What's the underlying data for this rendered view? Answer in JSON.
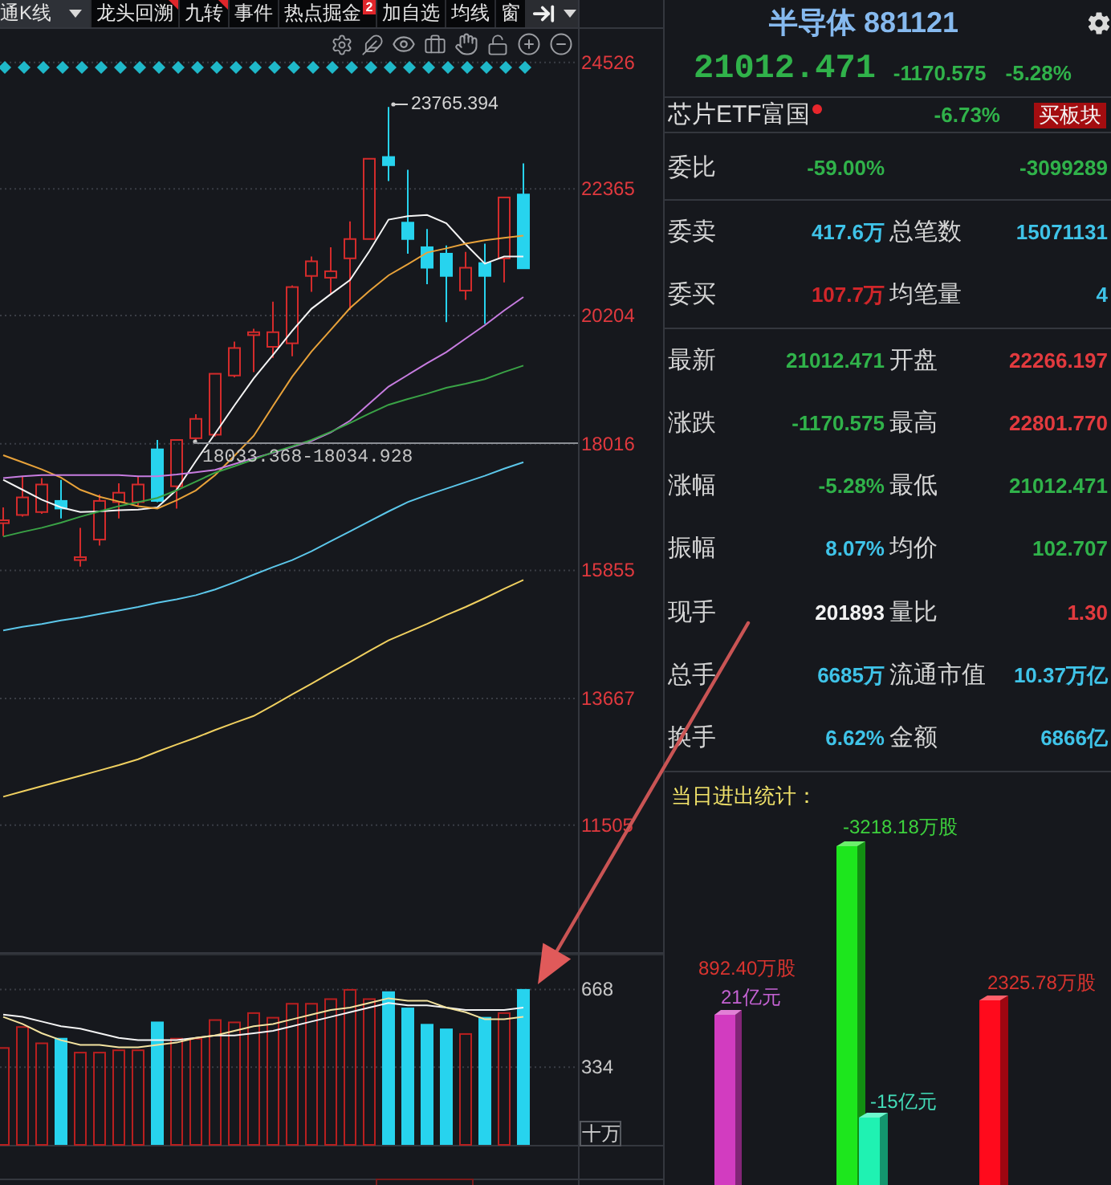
{
  "toolbar": {
    "tabs": [
      {
        "label": "通K线",
        "kind": "select",
        "flag": false
      },
      {
        "label": "龙头回溯",
        "kind": "tab",
        "flag": true
      },
      {
        "label": "九转",
        "kind": "tab",
        "flag": true
      },
      {
        "label": "事件",
        "kind": "tab",
        "flag": false
      },
      {
        "label": "热点掘金",
        "kind": "tab",
        "flag": false,
        "badge": "2"
      },
      {
        "label": "加自选",
        "kind": "tab",
        "flag": false
      },
      {
        "label": "均线",
        "kind": "tab",
        "flag": false
      },
      {
        "label": "窗",
        "kind": "tab",
        "flag": false
      }
    ]
  },
  "chart": {
    "chart_data": {
      "type": "candlestick",
      "ylim": [
        9310,
        25590
      ],
      "yticks": [
        24526,
        22365,
        20204,
        18016,
        15855,
        13667,
        11505
      ],
      "grid": true,
      "ohlc": [
        [
          16660,
          16930,
          16440,
          16710
        ],
        [
          16800,
          17450,
          16770,
          17100
        ],
        [
          16850,
          17430,
          16820,
          17320
        ],
        [
          17040,
          17400,
          16740,
          16910
        ],
        [
          16030,
          16580,
          15920,
          16080
        ],
        [
          16380,
          17150,
          16280,
          17040
        ],
        [
          17020,
          17340,
          16740,
          17180
        ],
        [
          17020,
          17450,
          16960,
          17320
        ],
        [
          17920,
          18080,
          17020,
          17040
        ],
        [
          17290,
          18080,
          16910,
          18080
        ],
        [
          18110,
          18520,
          18080,
          18440
        ],
        [
          18170,
          19210,
          18140,
          19210
        ],
        [
          19180,
          19760,
          19150,
          19650
        ],
        [
          19870,
          19980,
          19240,
          19920
        ],
        [
          19670,
          20440,
          19480,
          19920
        ],
        [
          19730,
          20720,
          19510,
          20690
        ],
        [
          20880,
          21210,
          20610,
          21130
        ],
        [
          20850,
          21370,
          20580,
          20960
        ],
        [
          21180,
          21810,
          20300,
          21510
        ],
        [
          21510,
          22880,
          21510,
          22880
        ],
        [
          22910,
          23765,
          22500,
          22770
        ],
        [
          21790,
          22690,
          21260,
          21510
        ],
        [
          21370,
          21680,
          20740,
          21020
        ],
        [
          21260,
          21400,
          20090,
          20880
        ],
        [
          20630,
          21290,
          20470,
          21020
        ],
        [
          21100,
          21430,
          20060,
          20880
        ],
        [
          21180,
          22220,
          20770,
          22220
        ],
        [
          22270,
          22800,
          21010,
          21010
        ]
      ],
      "series": [
        {
          "type": "line",
          "color": "#f4f4f4",
          "values": [
            17400,
            17230,
            17060,
            16930,
            16850,
            16860,
            16880,
            16890,
            16930,
            17230,
            17720,
            18190,
            18670,
            19130,
            19530,
            19940,
            20320,
            20570,
            20810,
            21300,
            21840,
            21900,
            21920,
            21780,
            21420,
            21090,
            21210,
            21210
          ]
        },
        {
          "type": "line",
          "color": "#e8a23a",
          "values": [
            17820,
            17700,
            17580,
            17440,
            17230,
            17110,
            17030,
            16950,
            16910,
            17050,
            17220,
            17480,
            17810,
            18150,
            18660,
            19160,
            19590,
            19960,
            20330,
            20620,
            20890,
            21080,
            21280,
            21350,
            21430,
            21490,
            21530,
            21570
          ]
        },
        {
          "type": "line",
          "color": "#c77ce0",
          "values": [
            17430,
            17460,
            17480,
            17480,
            17480,
            17480,
            17480,
            17460,
            17460,
            17490,
            17530,
            17570,
            17670,
            17770,
            17860,
            17960,
            18060,
            18210,
            18410,
            18700,
            18990,
            19190,
            19390,
            19580,
            19810,
            20040,
            20290,
            20520
          ]
        },
        {
          "type": "line",
          "color": "#3aa346",
          "values": [
            16430,
            16510,
            16580,
            16670,
            16770,
            16860,
            16950,
            17020,
            17090,
            17220,
            17370,
            17520,
            17630,
            17750,
            17870,
            17970,
            18080,
            18220,
            18370,
            18530,
            18680,
            18780,
            18870,
            18970,
            19040,
            19120,
            19240,
            19350
          ]
        },
        {
          "type": "line",
          "color": "#5cc7ea",
          "values": [
            14830,
            14890,
            14940,
            15000,
            15050,
            15110,
            15170,
            15230,
            15300,
            15360,
            15430,
            15530,
            15650,
            15780,
            15910,
            16030,
            16180,
            16350,
            16520,
            16690,
            16860,
            17020,
            17140,
            17250,
            17360,
            17470,
            17590,
            17700
          ]
        },
        {
          "type": "line",
          "color": "#f0d060",
          "values": [
            11990,
            12080,
            12170,
            12260,
            12350,
            12440,
            12530,
            12630,
            12760,
            12880,
            13000,
            13130,
            13250,
            13370,
            13550,
            13740,
            13920,
            14110,
            14290,
            14480,
            14660,
            14800,
            14940,
            15090,
            15230,
            15380,
            15540,
            15690
          ]
        }
      ]
    },
    "high_label": "23765.394",
    "range_label": "18033.368-18034.928"
  },
  "volume": {
    "chart_data": {
      "type": "bar",
      "ylim": [
        0,
        818
      ],
      "yticks": [
        668,
        334
      ],
      "grid": true,
      "series": [
        {
          "color": "#b81f1f",
          "values": [
            420,
            510,
            440,
            null,
            400,
            400,
            410,
            410,
            null,
            460,
            460,
            540,
            530,
            570,
            550,
            610,
            610,
            630,
            670,
            630,
            null,
            null,
            null,
            null,
            480,
            null,
            570,
            null
          ]
        },
        {
          "color": "#27d3ee",
          "values": [
            null,
            null,
            null,
            460,
            null,
            null,
            null,
            null,
            530,
            null,
            null,
            null,
            null,
            null,
            null,
            null,
            null,
            null,
            null,
            null,
            660,
            590,
            520,
            500,
            null,
            550,
            null,
            670
          ]
        },
        {
          "type": "line",
          "color": "#f4f4f4",
          "values": [
            560,
            550,
            530,
            510,
            500,
            480,
            460,
            450,
            450,
            450,
            460,
            470,
            470,
            480,
            490,
            510,
            530,
            550,
            570,
            590,
            610,
            600,
            600,
            590,
            580,
            580,
            580,
            590
          ]
        },
        {
          "type": "line",
          "color": "#f3e3a0",
          "values": [
            550,
            520,
            480,
            450,
            430,
            430,
            420,
            420,
            430,
            440,
            460,
            470,
            490,
            510,
            520,
            540,
            560,
            580,
            590,
            610,
            630,
            620,
            620,
            590,
            570,
            540,
            540,
            550
          ]
        }
      ]
    },
    "unit": "十万"
  },
  "quote": {
    "title": "半导体 881121",
    "price": {
      "text": "21012.471",
      "color": "#30b24a"
    },
    "change": {
      "text": "-1170.575",
      "color": "#30b24a"
    },
    "change_pct": {
      "text": "-5.28%",
      "color": "#30b24a"
    }
  },
  "etf": {
    "name": "芯片ETF富国",
    "alert": true,
    "change_pct": {
      "text": "-6.73%",
      "color": "#30b24a"
    },
    "button": "买板块"
  },
  "quote_table": {
    "sections": [
      {
        "rows": [
          {
            "label": "委比",
            "value": {
              "text": "-59.00%",
              "color": "#30b24a"
            },
            "value_2": {
              "text": "-3099289",
              "color": "#30b24a"
            }
          }
        ]
      },
      {
        "rows": [
          {
            "label": "委卖",
            "value": {
              "text": "417.6万",
              "color": "#3fc3e8"
            },
            "label_2": "总笔数",
            "value_2": {
              "text": "15071131",
              "color": "#3fc3e8"
            }
          },
          {
            "label": "委买",
            "value": {
              "text": "107.7万",
              "color": "#d0262a"
            },
            "label_2": "均笔量",
            "value_2": {
              "text": "4",
              "color": "#3fc3e8"
            }
          }
        ]
      },
      {
        "rows": [
          {
            "label": "最新",
            "value": {
              "text": "21012.471",
              "color": "#30b24a"
            },
            "label_2": "开盘",
            "value_2": {
              "text": "22266.197",
              "color": "#e23a3e"
            }
          },
          {
            "label": "涨跌",
            "value": {
              "text": "-1170.575",
              "color": "#30b24a"
            },
            "label_2": "最高",
            "value_2": {
              "text": "22801.770",
              "color": "#e23a3e"
            }
          },
          {
            "label": "涨幅",
            "value": {
              "text": "-5.28%",
              "color": "#30b24a"
            },
            "label_2": "最低",
            "value_2": {
              "text": "21012.471",
              "color": "#30b24a"
            }
          },
          {
            "label": "振幅",
            "value": {
              "text": "8.07%",
              "color": "#3fc3e8"
            },
            "label_2": "均价",
            "value_2": {
              "text": "102.707",
              "color": "#30b24a"
            }
          },
          {
            "label": "现手",
            "value": {
              "text": "201893",
              "color": "#f2f2f2"
            },
            "label_2": "量比",
            "value_2": {
              "text": "1.30",
              "color": "#e23a3e"
            }
          },
          {
            "label": "总手",
            "value": {
              "text": "6685万",
              "color": "#3fc3e8"
            },
            "label_2": "流通市值",
            "value_2": {
              "text": "10.37万亿",
              "color": "#3fc3e8"
            }
          },
          {
            "label": "换手",
            "value": {
              "text": "6.62%",
              "color": "#3fc3e8"
            },
            "label_2": "金额",
            "value_2": {
              "text": "6866亿",
              "color": "#3fc3e8"
            }
          }
        ]
      }
    ]
  },
  "flow_stats": {
    "title": "当日进出统计：",
    "bars": [
      {
        "color": "#d23cc0",
        "labels": [
          {
            "text": "892.40万股",
            "color": "#d9342f"
          },
          {
            "text": "21亿元",
            "color": "#c462d2"
          }
        ]
      },
      {
        "color": "#1de61d",
        "labels": [
          {
            "text": "-3218.18万股",
            "color": "#3dd13d"
          }
        ]
      },
      {
        "color": "#1ff2b2",
        "labels": [
          {
            "text": "-15亿元",
            "color": "#43dcb8"
          }
        ]
      },
      {
        "color": "#ff0a1c",
        "labels": [
          {
            "text": "2325.78万股",
            "color": "#d9342f"
          }
        ]
      }
    ]
  }
}
